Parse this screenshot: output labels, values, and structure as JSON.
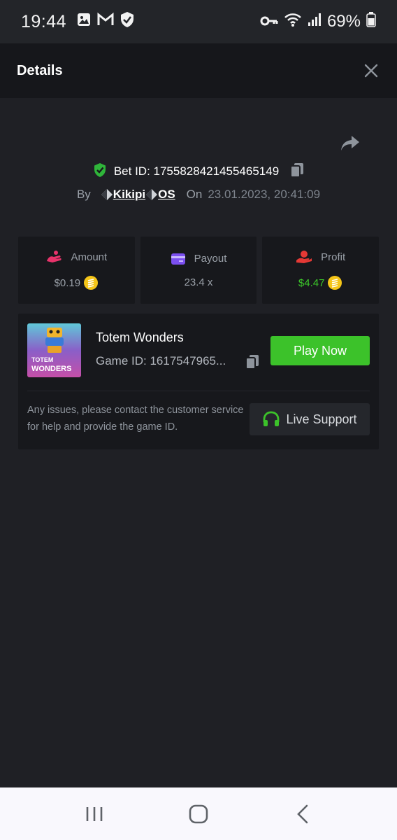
{
  "status_bar": {
    "time": "19:44",
    "battery": "69%"
  },
  "header": {
    "title": "Details"
  },
  "bet": {
    "id_label": "Bet ID: 1755828421455465149",
    "by_label": "By",
    "username": "Kikipi",
    "username_suffix": "OS",
    "on_label": "On",
    "date": "23.01.2023, 20:41:09"
  },
  "stats": {
    "amount": {
      "label": "Amount",
      "value": "$0.19"
    },
    "payout": {
      "label": "Payout",
      "value": "23.4 x"
    },
    "profit": {
      "label": "Profit",
      "value": "$4.47"
    }
  },
  "game": {
    "name": "Totem Wonders",
    "id_label": "Game ID: 1617547965...",
    "thumb_line1": "TOTEM",
    "thumb_line2": "WONDERS",
    "play_label": "Play Now",
    "help_text": "Any issues, please contact the customer service for help and provide the game ID.",
    "support_label": "Live Support"
  },
  "colors": {
    "accent_green": "#3cc22a",
    "amount_icon": "#e8336b",
    "payout_icon": "#7b4ff0",
    "profit_icon": "#e53935",
    "coin": "#f5c518"
  },
  "icons": [
    "photo-icon",
    "gmail-icon",
    "shield-icon",
    "key-icon",
    "wifi-icon",
    "signal-icon",
    "battery-icon",
    "close-icon",
    "share-icon",
    "verified-shield-icon",
    "copy-icon",
    "gem-icon",
    "amount-icon",
    "payout-icon",
    "profit-icon",
    "coin-icon",
    "headphones-icon",
    "recents-icon",
    "home-icon",
    "back-icon"
  ]
}
